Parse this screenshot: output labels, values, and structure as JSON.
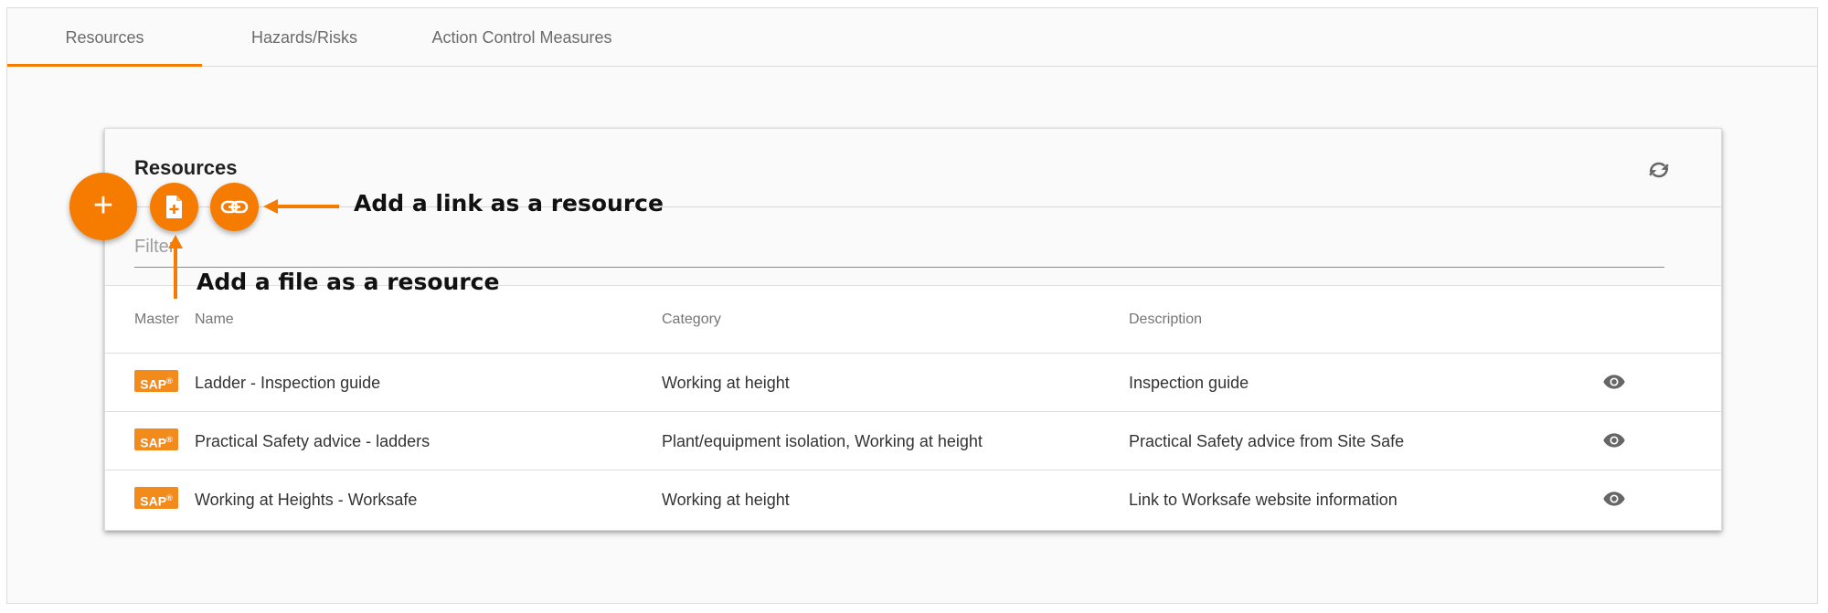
{
  "tabs": [
    "Resources",
    "Hazards/Risks",
    "Action Control Measures"
  ],
  "active_tab": "Resources",
  "card": {
    "title": "Resources",
    "filter_placeholder": "Filter"
  },
  "table": {
    "headers": {
      "master": "Master",
      "name": "Name",
      "category": "Category",
      "description": "Description"
    },
    "rows": [
      {
        "badge": "SAP",
        "name": "Ladder - Inspection guide",
        "category": "Working at height",
        "description": "Inspection guide"
      },
      {
        "badge": "SAP",
        "name": "Practical Safety advice - ladders",
        "category": "Plant/equipment isolation, Working at height",
        "description": "Practical Safety advice from Site Safe"
      },
      {
        "badge": "SAP",
        "name": "Working at Heights - Worksafe",
        "category": "Working at height",
        "description": "Link to Worksafe website information"
      }
    ]
  },
  "fab": {
    "main_symbol": "+"
  },
  "annotations": {
    "link": "Add a link as a resource",
    "file": "Add a file as a resource"
  },
  "colors": {
    "accent": "#f57c00",
    "badge": "#f28a1c"
  },
  "icons": [
    "refresh-icon",
    "add-file-icon",
    "link-icon",
    "eye-icon"
  ]
}
